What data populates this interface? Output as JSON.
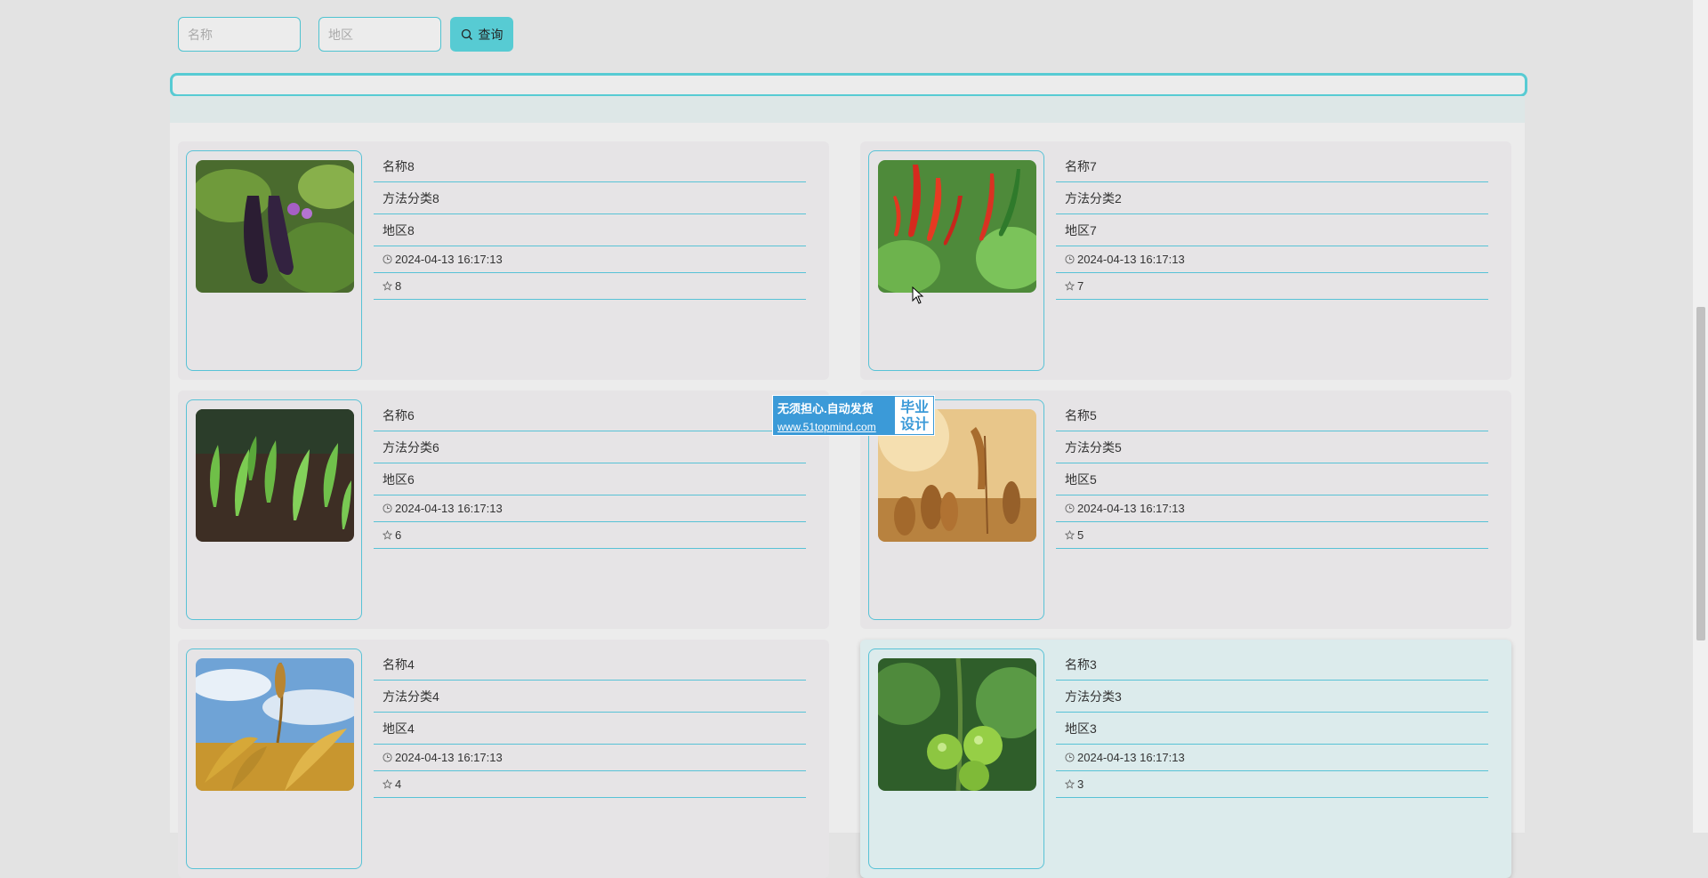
{
  "search": {
    "name_placeholder": "名称",
    "region_placeholder": "地区",
    "button_label": "查询"
  },
  "cards": [
    {
      "name": "名称8",
      "category": "方法分类8",
      "region": "地区8",
      "time": "2024-04-13 16:17:13",
      "favorites": "8",
      "image": "eggplant"
    },
    {
      "name": "名称7",
      "category": "方法分类2",
      "region": "地区7",
      "time": "2024-04-13 16:17:13",
      "favorites": "7",
      "image": "chili-pepper"
    },
    {
      "name": "名称6",
      "category": "方法分类6",
      "region": "地区6",
      "time": "2024-04-13 16:17:13",
      "favorites": "6",
      "image": "seedlings"
    },
    {
      "name": "名称5",
      "category": "方法分类5",
      "region": "地区5",
      "time": "2024-04-13 16:17:13",
      "favorites": "5",
      "image": "wheat"
    },
    {
      "name": "名称4",
      "category": "方法分类4",
      "region": "地区4",
      "time": "2024-04-13 16:17:13",
      "favorites": "4",
      "image": "dry-wheat-sky"
    },
    {
      "name": "名称3",
      "category": "方法分类3",
      "region": "地区3",
      "time": "2024-04-13 16:17:13",
      "favorites": "3",
      "image": "green-tomato"
    }
  ],
  "watermark": {
    "line1": "无须担心.自动发货",
    "url": "www.51topmind.com",
    "badge_line1": "毕业",
    "badge_line2": "设计"
  },
  "colors": {
    "accent": "#57cbd3",
    "border": "#58c2d6",
    "watermark": "#3b9ad8"
  }
}
